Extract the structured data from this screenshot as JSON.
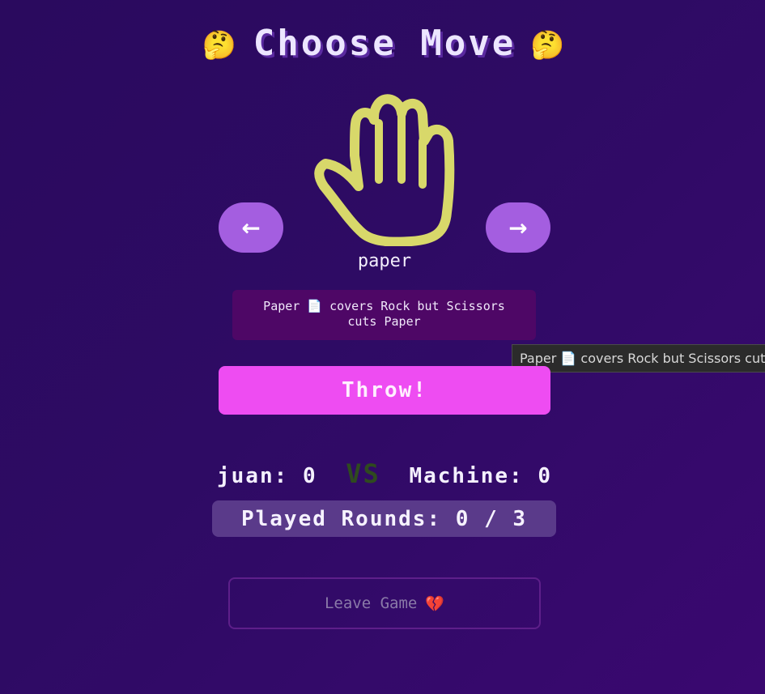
{
  "header": {
    "emoji_left": "🤔",
    "title": "Choose Move",
    "emoji_right": "🤔"
  },
  "move_selector": {
    "prev_label": "←",
    "next_label": "→",
    "current_move": "paper",
    "hand_icon": "open-hand-icon",
    "hand_color": "#d8d86a",
    "description": "Paper 📄 covers Rock but Scissors cuts Paper"
  },
  "tooltip": {
    "text": "Paper 📄 covers Rock but Scissors cuts Paper"
  },
  "actions": {
    "throw_label": "Throw!",
    "leave_label": "Leave Game",
    "leave_emoji": "💔"
  },
  "scoreboard": {
    "player_name": "juan:",
    "player_score": "0",
    "vs_label": "VS",
    "opponent_name": "Machine:",
    "opponent_score": "0",
    "rounds_label": "Played Rounds:",
    "rounds_played": "0",
    "rounds_separator": "/",
    "rounds_total": "3"
  },
  "colors": {
    "background": "#2e0b64",
    "accent_pink": "#ee4cf2",
    "arrow_purple": "#a45ee0",
    "description_bg": "#4e0766",
    "rounds_bg": "#5a3a8a"
  }
}
